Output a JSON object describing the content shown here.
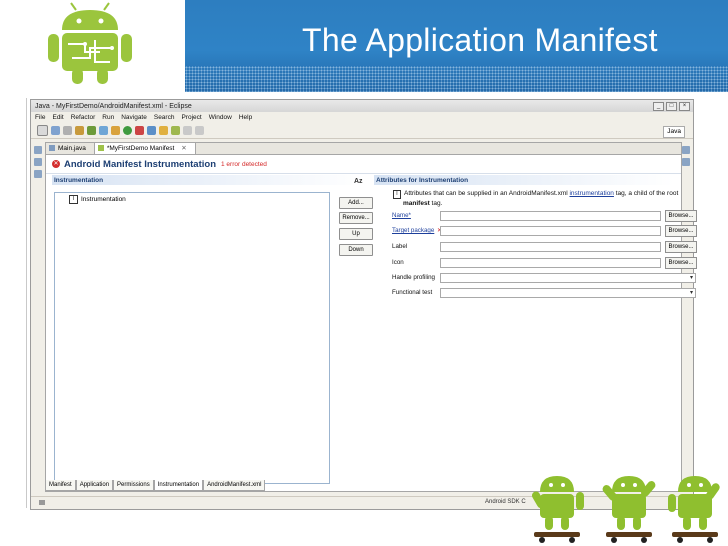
{
  "slide": {
    "title": "The Application Manifest"
  },
  "window": {
    "title": "Java - MyFirstDemo/AndroidManifest.xml - Eclipse",
    "menu": [
      "File",
      "Edit",
      "Refactor",
      "Run",
      "Navigate",
      "Search",
      "Project",
      "Window",
      "Help"
    ],
    "perspective": "Java"
  },
  "editor": {
    "tabs": [
      {
        "label": "Main.java"
      },
      {
        "label": "*MyFirstDemo Manifest"
      }
    ],
    "form_title": "Android Manifest Instrumentation",
    "error_message": "1 error detected",
    "left_section": "Instrumentation",
    "sort_label": "Az",
    "tree_items": [
      "Instrumentation"
    ],
    "buttons": [
      "Add...",
      "Remove...",
      "Up",
      "Down"
    ],
    "right_section": "Attributes for Instrumentation",
    "info_text_1": "Attributes that can be supplied in an AndroidManifest.xml ",
    "info_link": "instrumentation",
    "info_text_2": " tag, a child of the root",
    "info_bold": "manifest",
    "info_text_3": " tag.",
    "fields": {
      "name": {
        "label": "Name*",
        "button": "Browse..."
      },
      "target_package": {
        "label": "Target package",
        "button": "Browse..."
      },
      "label": {
        "label": "Label",
        "button": "Browse..."
      },
      "icon": {
        "label": "Icon",
        "button": "Browse..."
      },
      "handle_profiling": {
        "label": "Handle profiling"
      },
      "functional_test": {
        "label": "Functional test"
      }
    },
    "bottom_tabs": [
      "Manifest",
      "Application",
      "Permissions",
      "Instrumentation",
      "AndroidManifest.xml"
    ]
  },
  "status": {
    "sdk": "Android SDK C"
  },
  "colors": {
    "banner": "#2f83c6",
    "android_green": "#a4c639",
    "error_red": "#d42828"
  }
}
